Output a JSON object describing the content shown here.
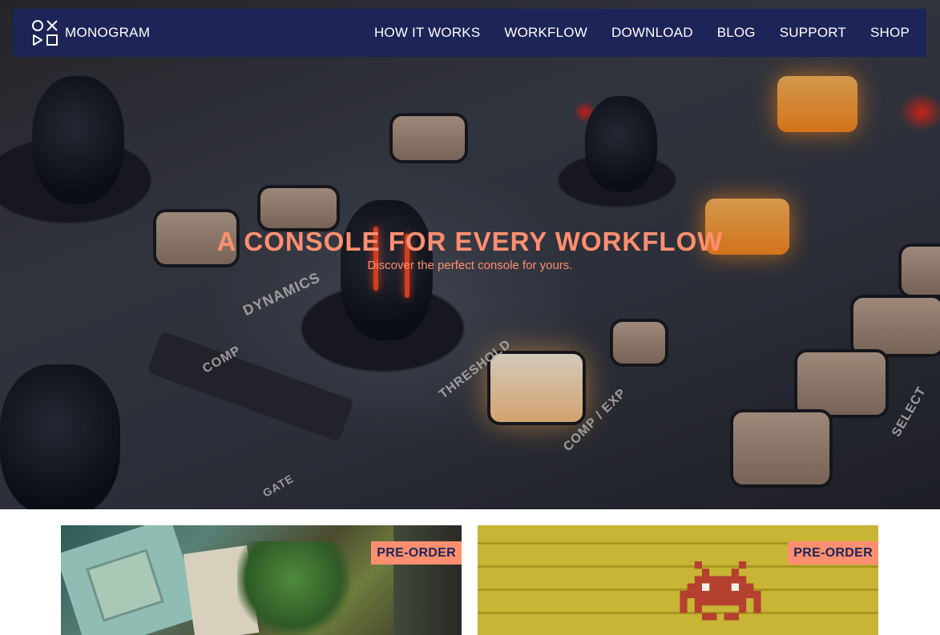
{
  "brand": {
    "name": "MONOGRAM",
    "logo_icon": "monogram-logo-icon"
  },
  "nav": {
    "items": [
      {
        "label": "HOW IT WORKS"
      },
      {
        "label": "WORKFLOW"
      },
      {
        "label": "DOWNLOAD"
      },
      {
        "label": "BLOG"
      },
      {
        "label": "SUPPORT"
      },
      {
        "label": "SHOP"
      }
    ]
  },
  "hero": {
    "title": "A CONSOLE FOR EVERY WORKFLOW",
    "subtitle": "Discover the perfect console for yours.",
    "panel_labels": [
      "DYNAMICS",
      "COMP",
      "THRESHOLD",
      "COMP / EXP",
      "SELECT",
      "GATE"
    ]
  },
  "cards": [
    {
      "badge": "PRE-ORDER"
    },
    {
      "badge": "PRE-ORDER"
    }
  ],
  "colors": {
    "nav_bg": "#1d2457",
    "accent": "#ff8f70",
    "badge_text": "#1d2457"
  }
}
